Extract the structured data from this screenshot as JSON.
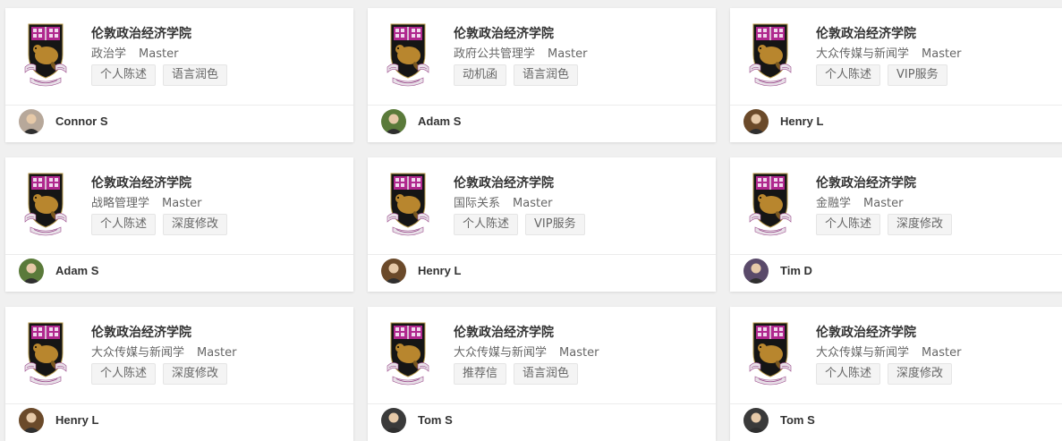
{
  "cards": [
    {
      "school": "伦敦政治经济学院",
      "major": "政治学",
      "degree": "Master",
      "tags": [
        "个人陈述",
        "语言润色"
      ],
      "author": "Connor S"
    },
    {
      "school": "伦敦政治经济学院",
      "major": "政府公共管理学",
      "degree": "Master",
      "tags": [
        "动机函",
        "语言润色"
      ],
      "author": "Adam S"
    },
    {
      "school": "伦敦政治经济学院",
      "major": "大众传媒与新闻学",
      "degree": "Master",
      "tags": [
        "个人陈述",
        "VIP服务"
      ],
      "author": "Henry L"
    },
    {
      "school": "伦敦政治经济学院",
      "major": "战略管理学",
      "degree": "Master",
      "tags": [
        "个人陈述",
        "深度修改"
      ],
      "author": "Adam S"
    },
    {
      "school": "伦敦政治经济学院",
      "major": "国际关系",
      "degree": "Master",
      "tags": [
        "个人陈述",
        "VIP服务"
      ],
      "author": "Henry L"
    },
    {
      "school": "伦敦政治经济学院",
      "major": "金融学",
      "degree": "Master",
      "tags": [
        "个人陈述",
        "深度修改"
      ],
      "author": "Tim D"
    },
    {
      "school": "伦敦政治经济学院",
      "major": "大众传媒与新闻学",
      "degree": "Master",
      "tags": [
        "个人陈述",
        "深度修改"
      ],
      "author": "Henry L"
    },
    {
      "school": "伦敦政治经济学院",
      "major": "大众传媒与新闻学",
      "degree": "Master",
      "tags": [
        "推荐信",
        "语言润色"
      ],
      "author": "Tom S"
    },
    {
      "school": "伦敦政治经济学院",
      "major": "大众传媒与新闻学",
      "degree": "Master",
      "tags": [
        "个人陈述",
        "深度修改"
      ],
      "author": "Tom S"
    }
  ],
  "crest": {
    "icon": "lse-crest-icon",
    "motto": "RERUM COGNOSCERE CAUSAS",
    "shield_color": "#151515",
    "beaver_color": "#b8862e",
    "chief_color": "#b0288e",
    "scroll_color": "#e8e0e8"
  },
  "avatar_colors": {
    "Connor S": "#b7a89a",
    "Adam S": "#5a7a3a",
    "Henry L": "#6b4a2a",
    "Tim D": "#5a4a6a",
    "Tom S": "#3a3a3a"
  }
}
